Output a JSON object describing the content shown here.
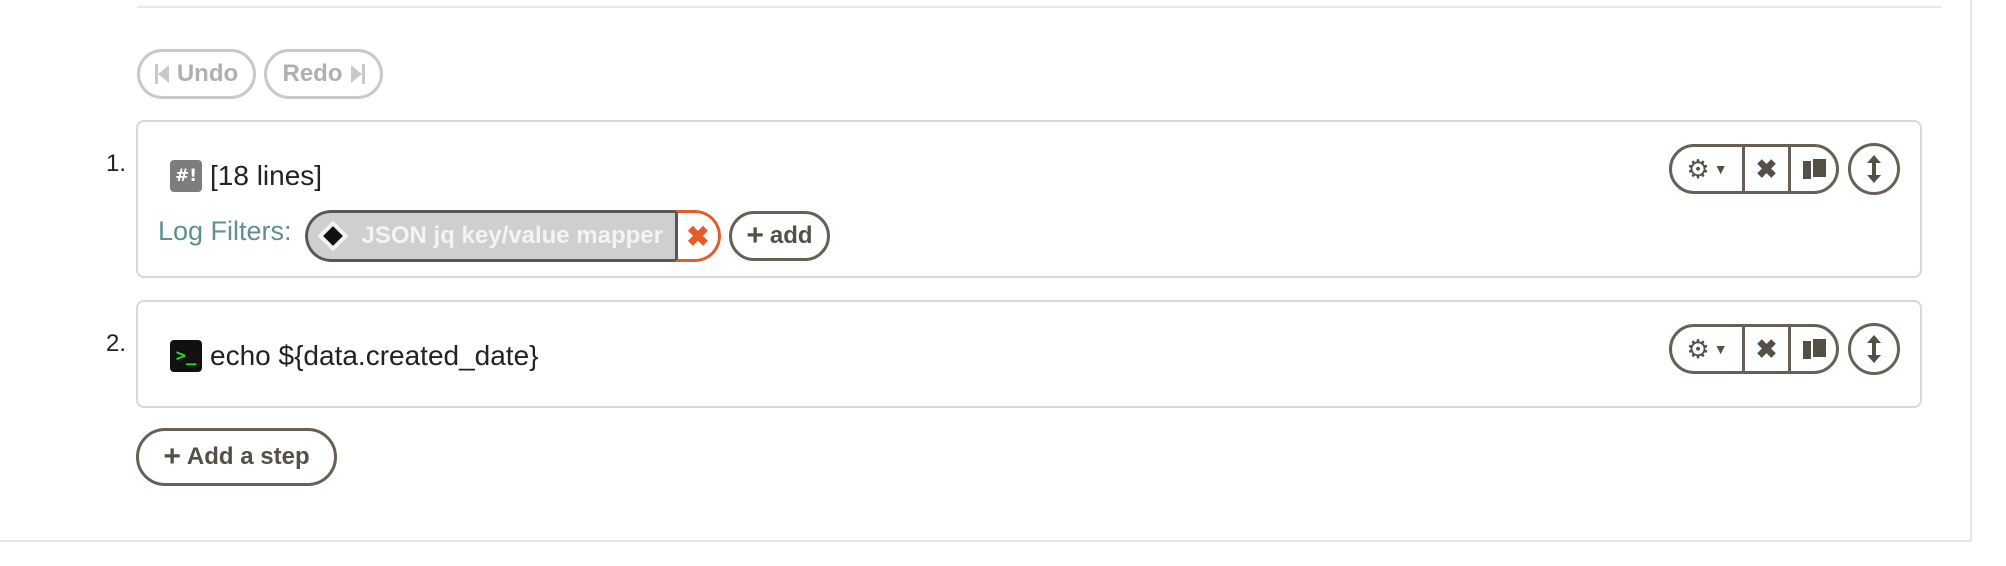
{
  "history": {
    "undo_label": "Undo",
    "redo_label": "Redo"
  },
  "steps": [
    {
      "number": "1.",
      "icon": "shebang-script-icon",
      "icon_glyph": "#!",
      "text": "[18 lines]",
      "log_filters_label": "Log Filters:",
      "filters": [
        {
          "label": "JSON jq key/value mapper",
          "icon": "jq-diamond-icon"
        }
      ],
      "add_filter_label": "add"
    },
    {
      "number": "2.",
      "icon": "terminal-icon",
      "icon_glyph": ">_",
      "text": "echo ${data.created_date}"
    }
  ],
  "add_step_label": "Add a step",
  "colors": {
    "button_border": "#666055",
    "disabled": "#c9c9c9",
    "remove_accent": "#e35d2b",
    "log_label": "#5f8f8f",
    "terminal_green": "#22e022"
  }
}
